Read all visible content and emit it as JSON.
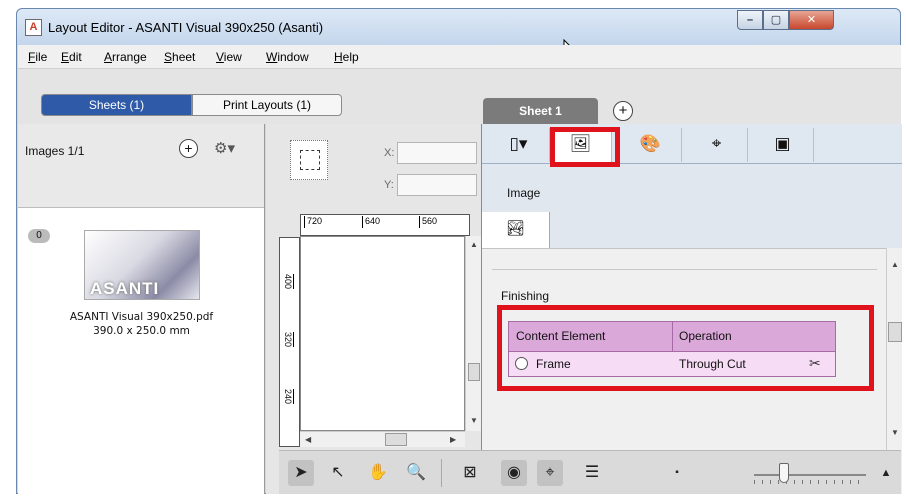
{
  "window": {
    "app_icon_text": "A",
    "title": "Layout Editor - ASANTI Visual 390x250 (Asanti)",
    "minimize_glyph": "–",
    "maximize_glyph": "▢",
    "close_glyph": "✕"
  },
  "menu": [
    "File",
    "Edit",
    "Arrange",
    "Sheet",
    "View",
    "Window",
    "Help"
  ],
  "tabs": {
    "sheets": "Sheets (1)",
    "print_layouts": "Print Layouts (1)",
    "sheet_tab": "Sheet 1",
    "add_glyph": "+"
  },
  "images_panel": {
    "label": "Images 1/1",
    "add_glyph": "+",
    "gear_glyph": "⚙▾",
    "badge": "0",
    "thumb_text": "ASANTI",
    "file_name": "ASANTI Visual 390x250.pdf",
    "file_size": "390.0 x 250.0 mm"
  },
  "coords": {
    "x_label": "X:",
    "y_label": "Y:"
  },
  "rulers": {
    "top": [
      "720",
      "640",
      "560"
    ],
    "left": [
      "400",
      "320",
      "240"
    ]
  },
  "inspector": {
    "tabs": [
      {
        "name": "book-icon",
        "glyph": "▯▾"
      },
      {
        "name": "image-icon",
        "glyph": "🖼"
      },
      {
        "name": "palette-icon",
        "glyph": "🎨"
      },
      {
        "name": "target-icon",
        "glyph": "⌖"
      },
      {
        "name": "layout-icon",
        "glyph": "▣"
      }
    ],
    "section_label": "Image",
    "image_subtab_glyph": "🏞",
    "finishing": {
      "title": "Finishing",
      "headers": [
        "Content Element",
        "Operation"
      ],
      "rows": [
        {
          "element": "Frame",
          "operation": "Through Cut"
        }
      ]
    },
    "knife_glyph": "✂"
  },
  "scroll_glyphs": {
    "up": "▲",
    "down": "▼",
    "left": "◀",
    "right": "▶"
  },
  "toolbar": {
    "select_glyph": "➤",
    "direct_select_glyph": "↖",
    "hand_glyph": "✋",
    "zoom_glyph": "🔍",
    "frame_glyph": "⊠",
    "eye_glyph": "◉",
    "crosshair_glyph": "⌖",
    "settings_glyph": "☰",
    "small_view_glyph": "▪",
    "large_view_glyph": "▲"
  },
  "colors": {
    "accent": "#2f5aa8",
    "highlight": "#e0131d",
    "finishing_header": "#dba8da",
    "finishing_row": "#f6dcf5"
  }
}
